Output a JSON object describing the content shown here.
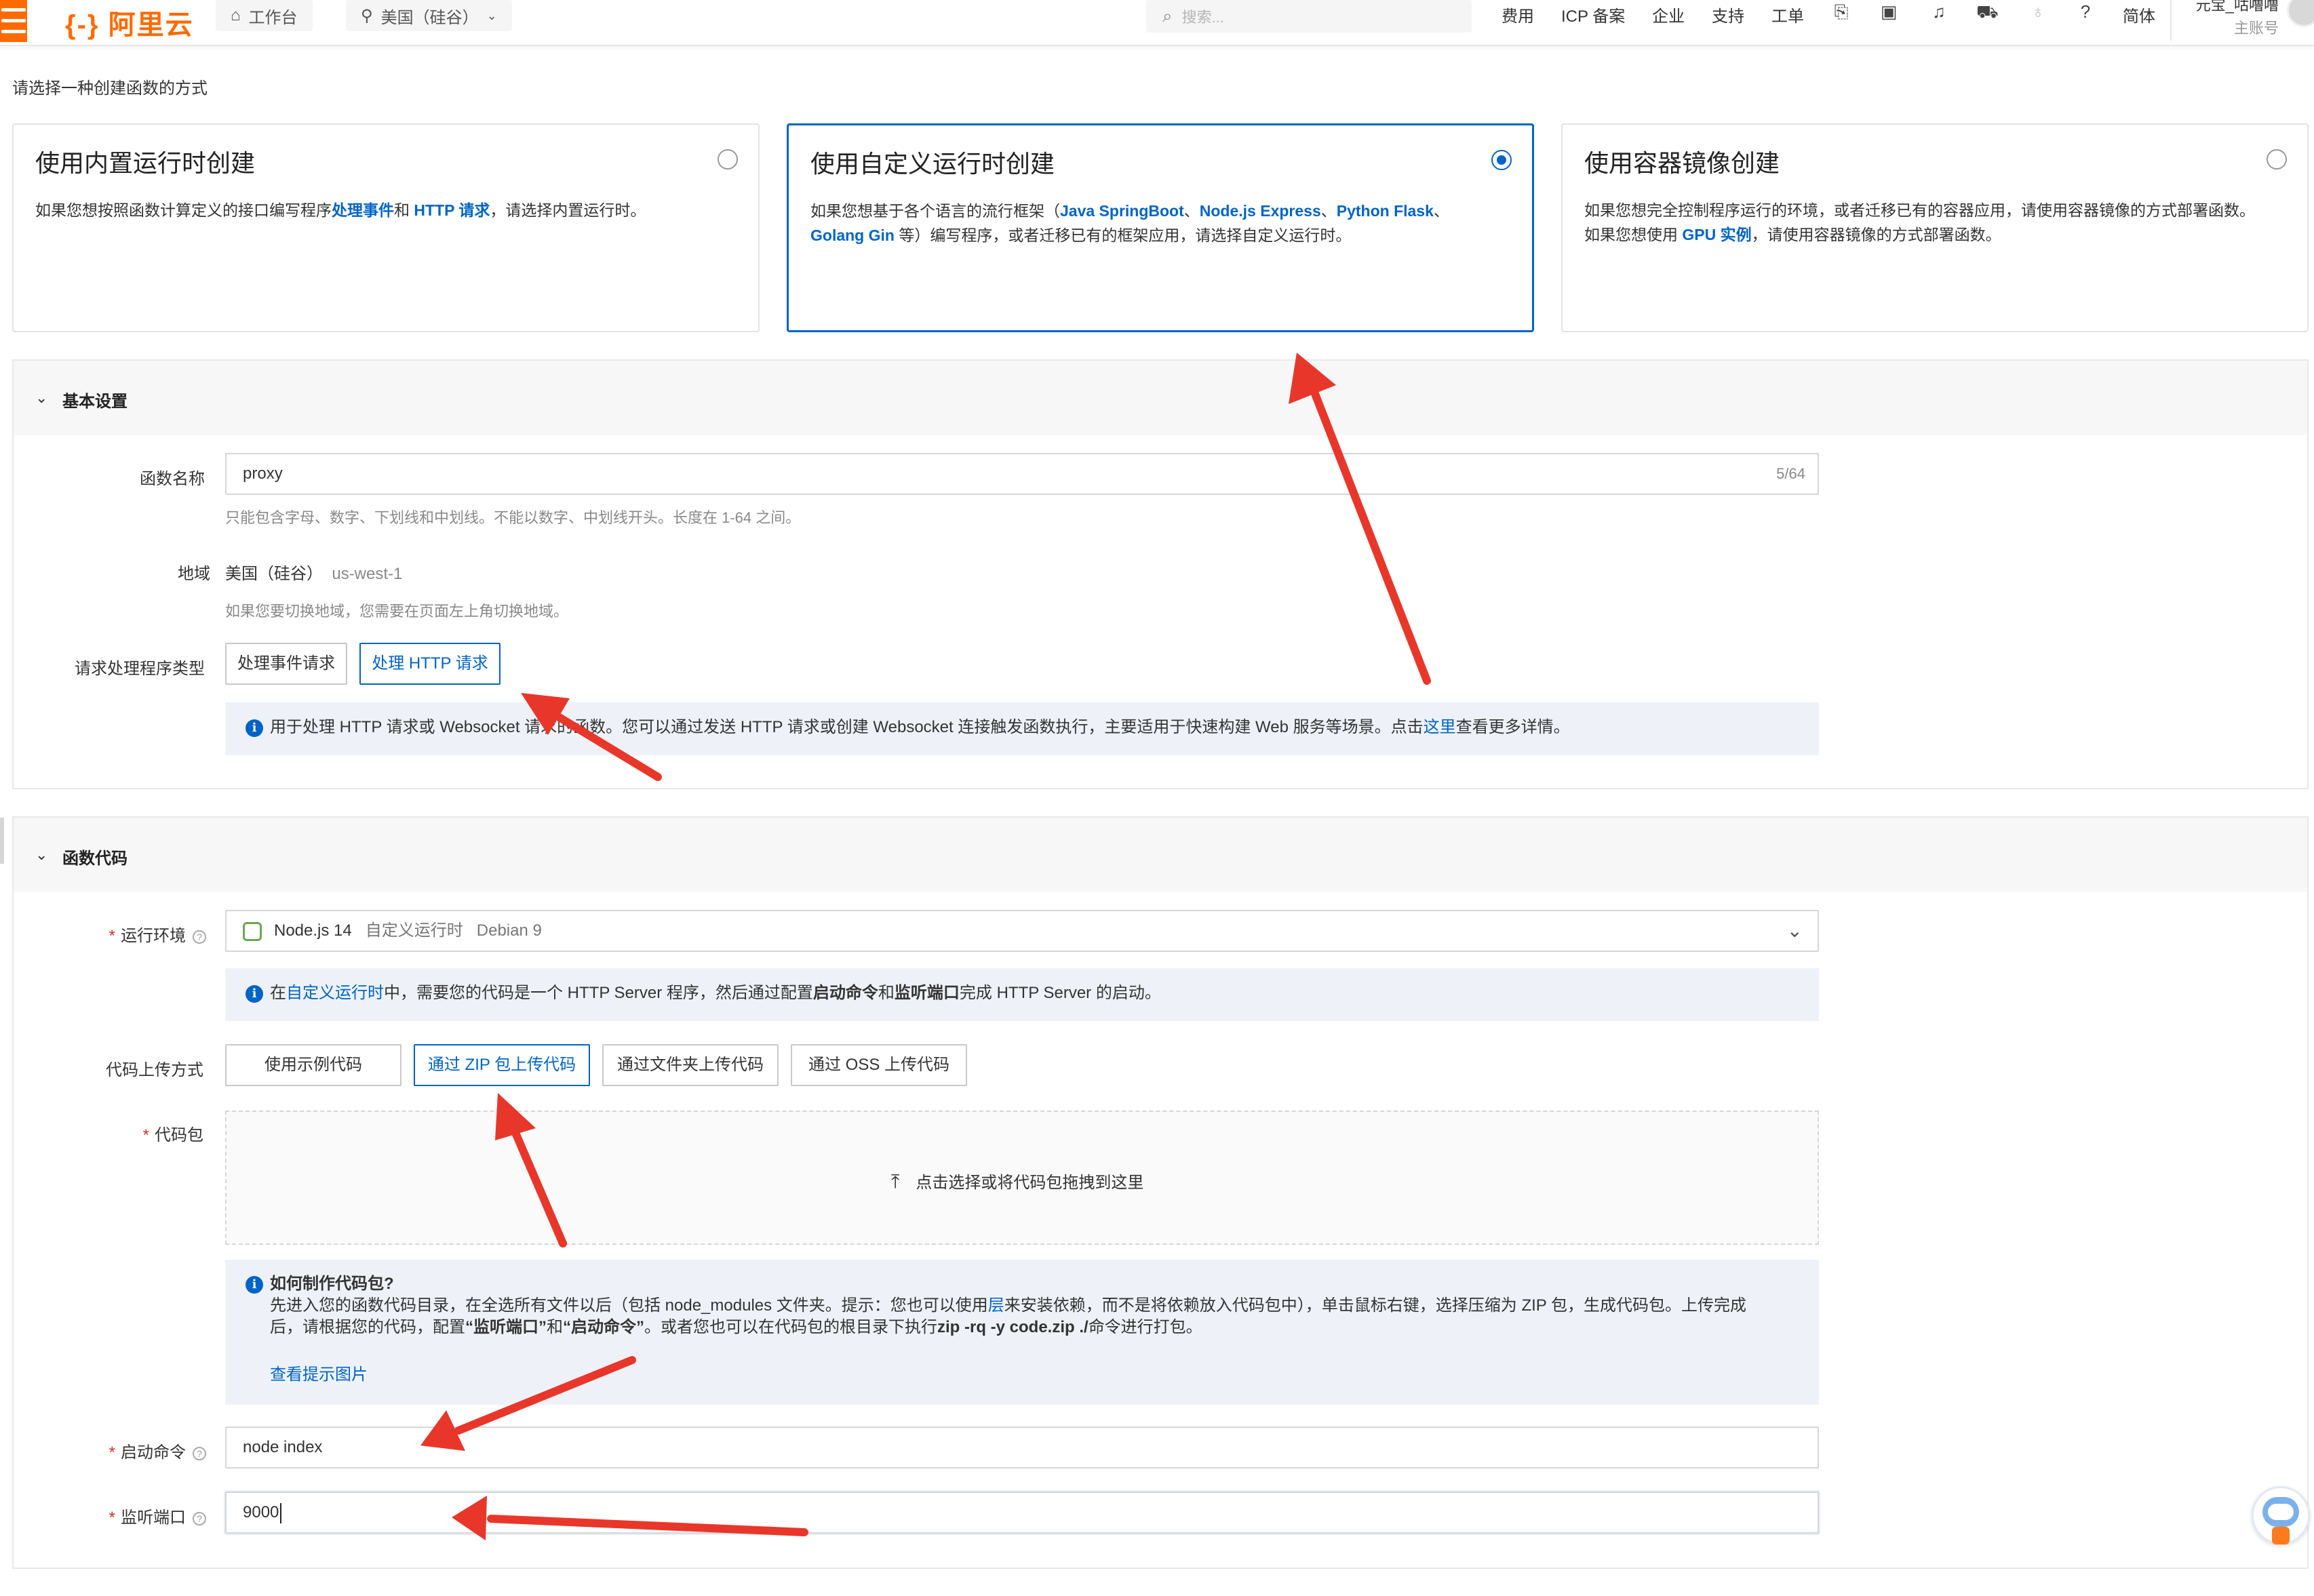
{
  "header": {
    "logo": "阿里云",
    "workbench": "工作台",
    "region": "美国（硅谷）",
    "search_placeholder": "搜索...",
    "nav": [
      "费用",
      "ICP 备案",
      "企业",
      "支持",
      "工单"
    ],
    "lang": "简体",
    "account_name": "元宝_咕噜噜",
    "account_sub": "主账号"
  },
  "page": {
    "prompt": "请选择一种创建函数的方式"
  },
  "cards": [
    {
      "title": "使用内置运行时创建",
      "desc_parts": [
        "如果您想按照函数计算定义的接口编写程序",
        "处理事件",
        "和 ",
        "HTTP 请求",
        "，请选择内置运行时。"
      ],
      "selected": false
    },
    {
      "title": "使用自定义运行时创建",
      "desc_parts": [
        "如果您想基于各个语言的流行框架（",
        "Java SpringBoot",
        "、",
        "Node.js Express",
        "、",
        "Python Flask",
        "、",
        "Golang Gin",
        " 等）编写程序，或者迁移已有的框架应用，请选择自定义运行时。"
      ],
      "selected": true
    },
    {
      "title": "使用容器镜像创建",
      "desc_parts": [
        "如果您想完全控制程序运行的环境，或者迁移已有的容器应用，请使用容器镜像的方式部署函数。如果您想使用 ",
        "GPU 实例",
        "，请使用容器镜像的方式部署函数。"
      ],
      "selected": false
    }
  ],
  "basic": {
    "section_title": "基本设置",
    "name_label": "函数名称",
    "name_value": "proxy",
    "name_count": "5/64",
    "name_hint": "只能包含字母、数字、下划线和中划线。不能以数字、中划线开头。长度在 1-64 之间。",
    "region_label": "地域",
    "region_value": "美国（硅谷）",
    "region_code": "us-west-1",
    "region_hint": "如果您要切换地域，您需要在页面左上角切换地域。",
    "handler_label": "请求处理程序类型",
    "handler_options": [
      "处理事件请求",
      "处理 HTTP 请求"
    ],
    "handler_selected": 1,
    "info_text_a": "用于处理 HTTP 请求或 Websocket 请求的函数。您可以通过发送 HTTP 请求或创建 Websocket 连接触发函数执行，主要适用于快速构建 Web 服务等场景。点击",
    "info_link": "这里",
    "info_text_b": "查看更多详情。"
  },
  "code": {
    "section_title": "函数代码",
    "runtime_label": "运行环境",
    "runtime_name": "Node.js 14",
    "runtime_type": "自定义运行时",
    "runtime_os": "Debian 9",
    "runtime_info_a": "在",
    "runtime_info_link": "自定义运行时",
    "runtime_info_b": "中，需要您的代码是一个 HTTP Server 程序，然后通过配置",
    "runtime_info_c": "启动命令",
    "runtime_info_d": "和",
    "runtime_info_e": "监听端口",
    "runtime_info_f": "完成 HTTP Server 的启动。",
    "upload_label": "代码上传方式",
    "upload_options": [
      "使用示例代码",
      "通过 ZIP 包上传代码",
      "通过文件夹上传代码",
      "通过 OSS 上传代码"
    ],
    "upload_selected": 1,
    "package_label": "代码包",
    "drop_text": "点击选择或将代码包拖拽到这里",
    "howto_title": "如何制作代码包?",
    "howto_line1_a": "先进入您的函数代码目录，在全选所有文件以后（包括 node_modules 文件夹。提示：您也可以使用",
    "howto_line1_link": "层",
    "howto_line1_b": "来安装依赖，而不是将依赖放入代码包中），单击鼠标右键，选择压缩为 ZIP 包，生成代码包。上传完成",
    "howto_line2_a": "后，请根据您的代码，配置",
    "howto_line2_b": "“监听端口”",
    "howto_line2_c": "和",
    "howto_line2_d": "“启动命令”",
    "howto_line2_e": "。或者您也可以在代码包的根目录下执行",
    "howto_line2_f": "zip -rq -y code.zip ./",
    "howto_line2_g": "命令进行打包。",
    "howto_link": "查看提示图片",
    "start_label": "启动命令",
    "start_value": "node index",
    "port_label": "监听端口",
    "port_value": "9000"
  },
  "colors": {
    "brand": "#ff6a00",
    "primary": "#0064c8",
    "arrow": "#e8372a"
  }
}
